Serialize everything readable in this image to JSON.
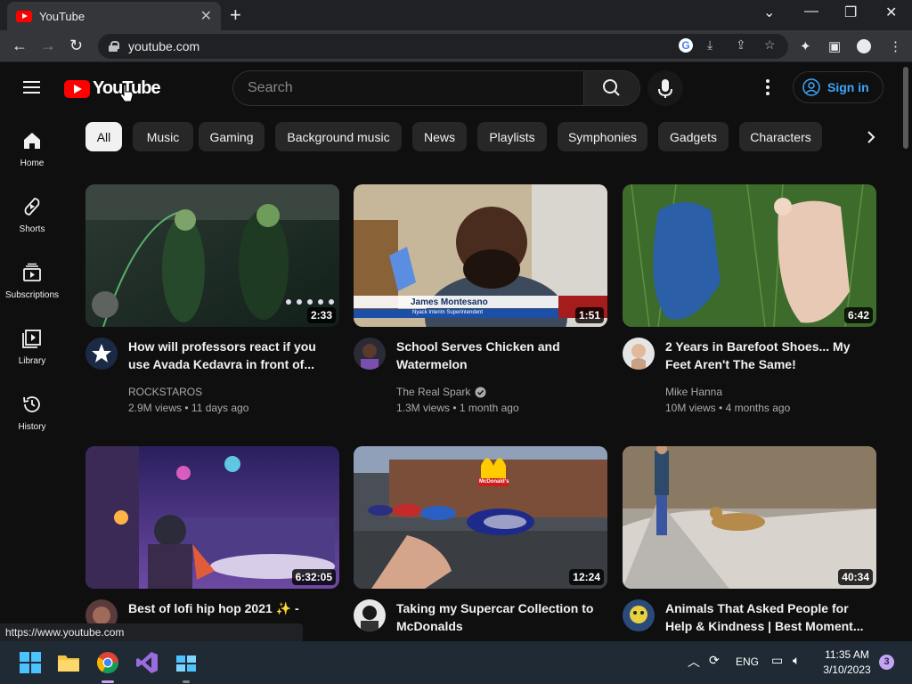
{
  "browser": {
    "tab_title": "YouTube",
    "url": "youtube.com",
    "status_url": "https://www.youtube.com"
  },
  "header": {
    "logo_text": "YouTube",
    "search_placeholder": "Search",
    "signin_label": "Sign in"
  },
  "sidebar": {
    "items": [
      {
        "label": "Home",
        "icon": "home-icon"
      },
      {
        "label": "Shorts",
        "icon": "shorts-icon"
      },
      {
        "label": "Subscriptions",
        "icon": "subscriptions-icon"
      },
      {
        "label": "Library",
        "icon": "library-icon"
      },
      {
        "label": "History",
        "icon": "history-icon"
      }
    ]
  },
  "chips": [
    "All",
    "Music",
    "Gaming",
    "Background music",
    "News",
    "Playlists",
    "Symphonies",
    "Gadgets",
    "Characters"
  ],
  "videos": [
    {
      "title": "How will professors react if you use Avada Kedavra in front of...",
      "channel": "ROCKSTAROS",
      "verified": false,
      "views": "2.9M views",
      "age": "11 days ago",
      "duration": "2:33"
    },
    {
      "title": "School Serves Chicken and Watermelon",
      "channel": "The Real Spark",
      "verified": true,
      "views": "1.3M views",
      "age": "1 month ago",
      "duration": "1:51",
      "lower_third_name": "James Montesano",
      "lower_third_role": "Nyack Interim Superintendent"
    },
    {
      "title": "2 Years in Barefoot Shoes... My Feet Aren't The Same!",
      "channel": "Mike Hanna",
      "verified": false,
      "views": "10M views",
      "age": "4 months ago",
      "duration": "6:42"
    },
    {
      "title": "Best of lofi hip hop 2021 ✨ -",
      "channel": "",
      "verified": false,
      "views": "",
      "age": "",
      "duration": "6:32:05"
    },
    {
      "title": "Taking my Supercar Collection to McDonalds",
      "channel": "",
      "verified": false,
      "views": "",
      "age": "",
      "duration": "12:24",
      "sign_text": "McDonald's"
    },
    {
      "title": "Animals That Asked People for Help & Kindness | Best Moment...",
      "channel": "",
      "verified": false,
      "views": "",
      "age": "",
      "duration": "40:34"
    }
  ],
  "taskbar": {
    "lang": "ENG",
    "time": "11:35 AM",
    "date": "3/10/2023",
    "notifications": "3"
  },
  "colors": {
    "background": "#0f0f0f",
    "chip": "#272727",
    "accent_link": "#3ea6ff",
    "youtube_red": "#ff0000"
  }
}
